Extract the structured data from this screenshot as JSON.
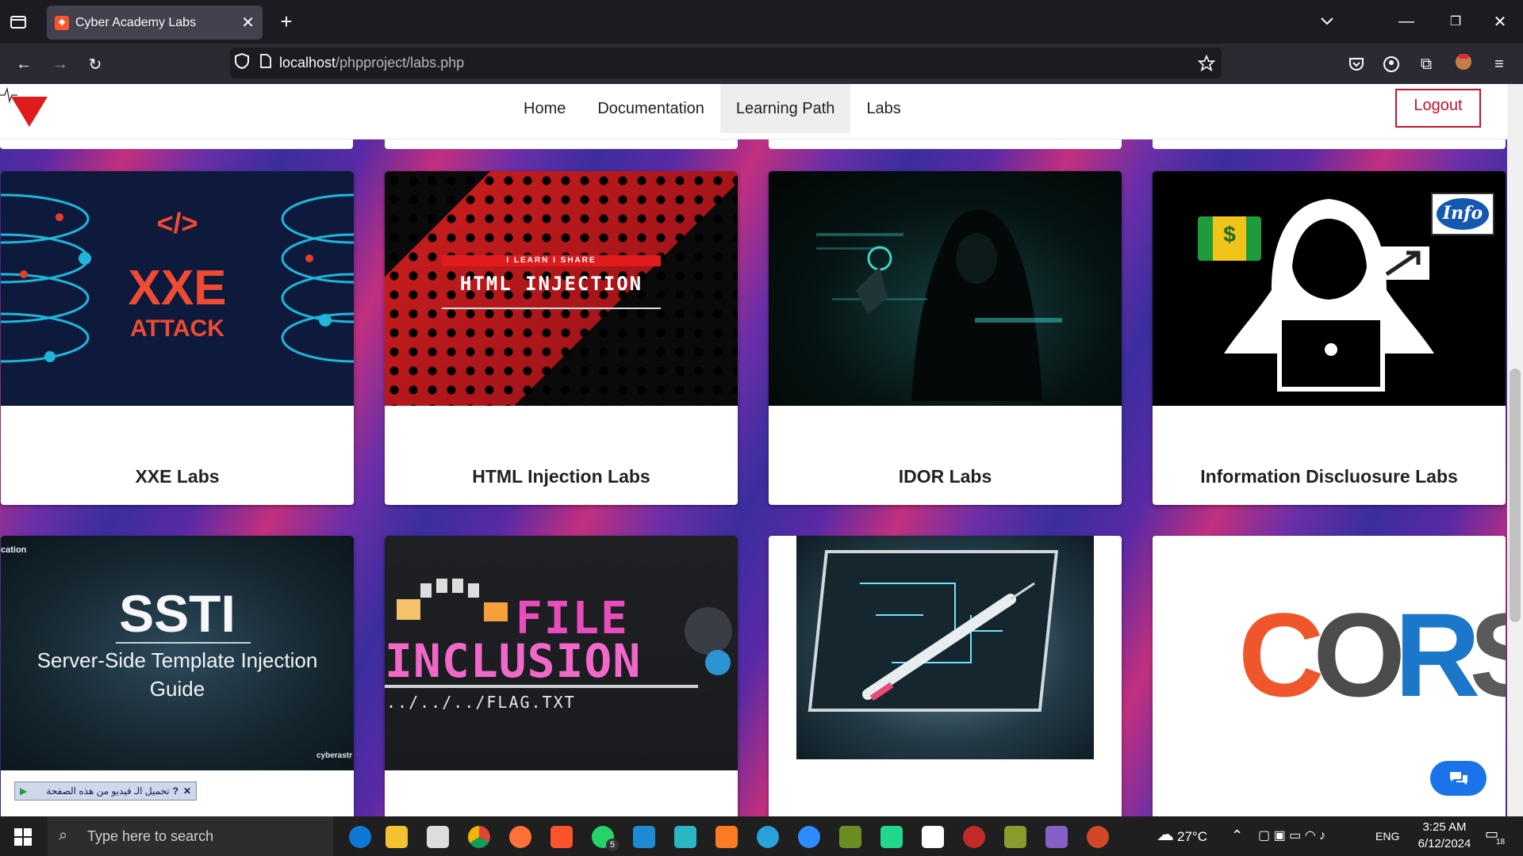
{
  "browser": {
    "tab_title": "Cyber Academy Labs",
    "url_host": "localhost",
    "url_path": "/phpproject/labs.php"
  },
  "header": {
    "nav": [
      "Home",
      "Documentation",
      "Learning Path",
      "Labs"
    ],
    "active_nav": "Learning Path",
    "logout_label": "Logout"
  },
  "cards_row1": [
    {
      "title": "XXE Labs",
      "image_text_1": "XXE",
      "image_text_2": "ATTACK",
      "image_text_3": "</>"
    },
    {
      "title": "HTML Injection Labs",
      "image_text_1": "I LEARN I SHARE",
      "image_text_2": "HTML INJECTION"
    },
    {
      "title": "IDOR Labs"
    },
    {
      "title": "Information Discluosure Labs",
      "image_text_1": "Info",
      "image_text_2": "$"
    }
  ],
  "cards_row2": [
    {
      "image_text_1": "SSTI",
      "image_text_2": "Server-Side Template Injection",
      "image_text_3": "Guide",
      "image_text_4": "cation",
      "image_text_5": "cyberastr"
    },
    {
      "image_text_1": "FILE",
      "image_text_2": "INCLUSION",
      "image_text_3": "../../../FLAG.TXT"
    },
    {},
    {
      "image_text_1": "C",
      "image_text_2": "O",
      "image_text_3": "R",
      "image_text_4": "S"
    }
  ],
  "download_bar_text": "تحميل الـ فيديو من هذه الصفحة",
  "taskbar": {
    "search_placeholder": "Type here to search",
    "weather": "27°C",
    "lang": "ENG",
    "time": "3:25 AM",
    "date": "6/12/2024",
    "notif_count": "18",
    "whatsapp_badge": "5"
  },
  "colors": {
    "accent_red": "#c8102e",
    "chat_blue": "#1a73e8"
  }
}
